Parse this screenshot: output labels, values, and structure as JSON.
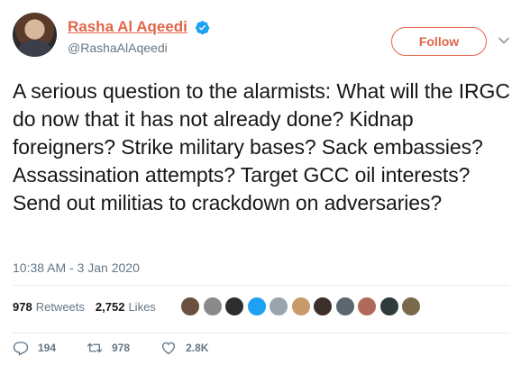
{
  "user": {
    "display_name": "Rasha Al Aqeedi",
    "handle": "@RashaAlAqeedi",
    "verified": true
  },
  "follow_label": "Follow",
  "tweet": {
    "text": "A serious question to the alarmists: What will the IRGC do now that it has not already done? Kidnap foreigners? Strike military bases? Sack embassies? Assassination attempts? Target GCC oil interests? Send out militias to crackdown on adversaries?",
    "timestamp": "10:38 AM - 3 Jan 2020"
  },
  "stats": {
    "retweets_count": "978",
    "retweets_label": "Retweets",
    "likes_count": "2,752",
    "likes_label": "Likes"
  },
  "likers": [
    {
      "name": "liker-1",
      "color": "#6b4f3f"
    },
    {
      "name": "liker-2",
      "color": "#8a8a8a"
    },
    {
      "name": "liker-3",
      "color": "#2d2d2d"
    },
    {
      "name": "liker-4",
      "color": "#1da1f2"
    },
    {
      "name": "liker-5",
      "color": "#9aa4ad"
    },
    {
      "name": "liker-6",
      "color": "#c89a6a"
    },
    {
      "name": "liker-7",
      "color": "#3d2f2a"
    },
    {
      "name": "liker-8",
      "color": "#5c6670"
    },
    {
      "name": "liker-9",
      "color": "#b06a5a"
    },
    {
      "name": "liker-10",
      "color": "#2f3a3a"
    },
    {
      "name": "liker-11",
      "color": "#7a6a4a"
    }
  ],
  "actions": {
    "reply_count": "194",
    "retweet_count": "978",
    "like_count": "2.8K"
  },
  "colors": {
    "accent": "#e0664b",
    "secondary_text": "#657786",
    "verified": "#1da1f2"
  }
}
